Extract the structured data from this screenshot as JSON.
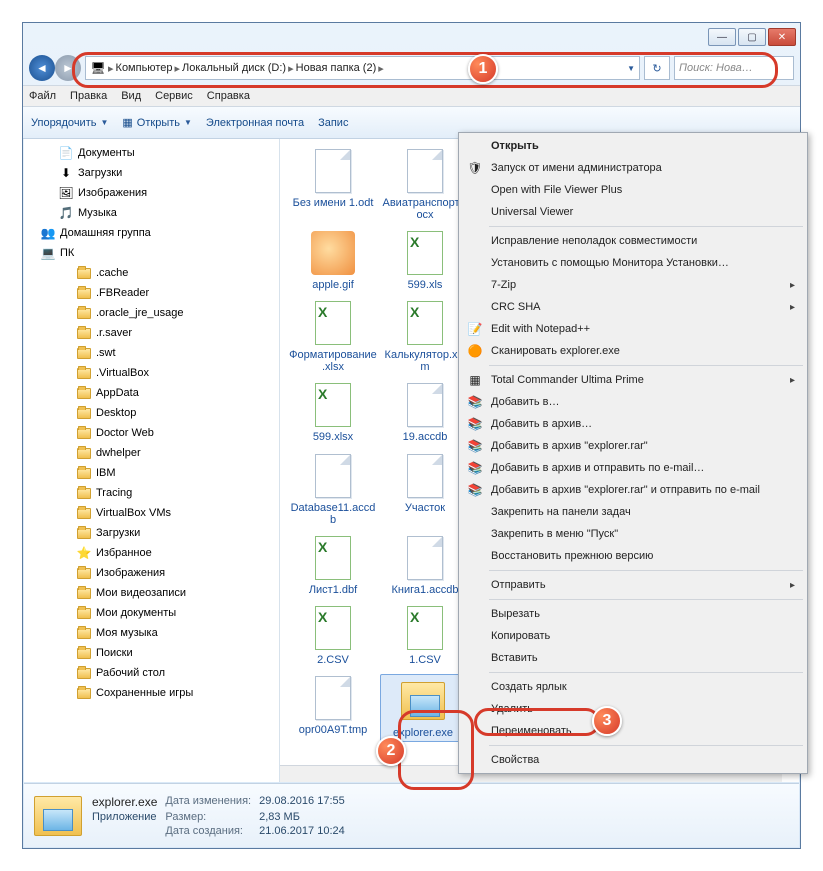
{
  "window_controls": {
    "min": "—",
    "max": "▢",
    "close": "✕"
  },
  "breadcrumb": {
    "root_icon": "computer-icon",
    "seg1": "Компьютер",
    "seg2": "Локальный диск (D:)",
    "seg3": "Новая папка (2)"
  },
  "search_placeholder": "Поиск: Нова…",
  "menu": {
    "file": "Файл",
    "edit": "Правка",
    "view": "Вид",
    "tools": "Сервис",
    "help": "Справка"
  },
  "toolbar": {
    "organize": "Упорядочить",
    "open": "Открыть",
    "email": "Электронная почта",
    "burn": "Запис"
  },
  "tree": [
    {
      "label": "Документы",
      "icon": "doc",
      "lvl": 1
    },
    {
      "label": "Загрузки",
      "icon": "dl",
      "lvl": 1
    },
    {
      "label": "Изображения",
      "icon": "pic",
      "lvl": 1
    },
    {
      "label": "Музыка",
      "icon": "music",
      "lvl": 1
    },
    {
      "label": "Домашняя группа",
      "icon": "group",
      "lvl": 0
    },
    {
      "label": "ПК",
      "icon": "pc",
      "lvl": 0
    },
    {
      "label": ".cache",
      "icon": "folder",
      "lvl": 2
    },
    {
      "label": ".FBReader",
      "icon": "folder",
      "lvl": 2
    },
    {
      "label": ".oracle_jre_usage",
      "icon": "folder",
      "lvl": 2
    },
    {
      "label": ".r.saver",
      "icon": "folder",
      "lvl": 2
    },
    {
      "label": ".swt",
      "icon": "folder",
      "lvl": 2
    },
    {
      "label": ".VirtualBox",
      "icon": "folder",
      "lvl": 2
    },
    {
      "label": "AppData",
      "icon": "folder",
      "lvl": 2
    },
    {
      "label": "Desktop",
      "icon": "folder",
      "lvl": 2
    },
    {
      "label": "Doctor Web",
      "icon": "folder",
      "lvl": 2
    },
    {
      "label": "dwhelper",
      "icon": "folder",
      "lvl": 2
    },
    {
      "label": "IBM",
      "icon": "folder",
      "lvl": 2
    },
    {
      "label": "Tracing",
      "icon": "folder",
      "lvl": 2
    },
    {
      "label": "VirtualBox VMs",
      "icon": "folder",
      "lvl": 2
    },
    {
      "label": "Загрузки",
      "icon": "folder",
      "lvl": 2
    },
    {
      "label": "Избранное",
      "icon": "fav",
      "lvl": 2
    },
    {
      "label": "Изображения",
      "icon": "folder",
      "lvl": 2
    },
    {
      "label": "Мои видеозаписи",
      "icon": "folder",
      "lvl": 2
    },
    {
      "label": "Мои документы",
      "icon": "folder",
      "lvl": 2
    },
    {
      "label": "Моя музыка",
      "icon": "folder",
      "lvl": 2
    },
    {
      "label": "Поиски",
      "icon": "folder",
      "lvl": 2
    },
    {
      "label": "Рабочий стол",
      "icon": "folder",
      "lvl": 2
    },
    {
      "label": "Сохраненные игры",
      "icon": "folder",
      "lvl": 2
    }
  ],
  "files": [
    {
      "name": "Без имени 1.odt",
      "icon": "doc"
    },
    {
      "name": "Авиатранспорт.docx",
      "icon": "word"
    },
    {
      "name": "apple.gif",
      "icon": "pic"
    },
    {
      "name": "599.xls",
      "icon": "xls"
    },
    {
      "name": "Форматирование.xlsx",
      "icon": "xls"
    },
    {
      "name": "Калькулятор.xlsm",
      "icon": "xls"
    },
    {
      "name": "599.xlsx",
      "icon": "xls"
    },
    {
      "name": "19.accdb",
      "icon": "acc"
    },
    {
      "name": "Database11.accdb",
      "icon": "doc"
    },
    {
      "name": "Участок",
      "icon": "doc"
    },
    {
      "name": "Лист1.dbf",
      "icon": "xls"
    },
    {
      "name": "Книга1.accdb",
      "icon": "doc"
    },
    {
      "name": "2.CSV",
      "icon": "csv"
    },
    {
      "name": "1.CSV",
      "icon": "csv"
    },
    {
      "name": "opr00A9T.tmp",
      "icon": "doc"
    },
    {
      "name": "explorer.exe",
      "icon": "expl",
      "selected": true
    }
  ],
  "context_menu": [
    {
      "label": "Открыть",
      "bold": true
    },
    {
      "label": "Запуск от имени администратора",
      "icon": "shield"
    },
    {
      "label": "Open with File Viewer Plus"
    },
    {
      "label": "Universal Viewer"
    },
    {
      "sep": true
    },
    {
      "label": "Исправление неполадок совместимости"
    },
    {
      "label": "Установить с помощью Монитора Установки…"
    },
    {
      "label": "7-Zip",
      "arrow": true
    },
    {
      "label": "CRC SHA",
      "arrow": true
    },
    {
      "label": "Edit with Notepad++",
      "icon": "npp"
    },
    {
      "label": "Сканировать explorer.exe",
      "icon": "avast"
    },
    {
      "sep": true
    },
    {
      "label": "Total Commander Ultima Prime",
      "icon": "tc",
      "arrow": true
    },
    {
      "label": "Добавить в…",
      "icon": "rar"
    },
    {
      "label": "Добавить в архив…",
      "icon": "rar"
    },
    {
      "label": "Добавить в архив \"explorer.rar\"",
      "icon": "rar"
    },
    {
      "label": "Добавить в архив и отправить по e-mail…",
      "icon": "rar"
    },
    {
      "label": "Добавить в архив \"explorer.rar\" и отправить по e-mail",
      "icon": "rar"
    },
    {
      "label": "Закрепить на панели задач"
    },
    {
      "label": "Закрепить в меню \"Пуск\""
    },
    {
      "label": "Восстановить прежнюю версию"
    },
    {
      "sep": true
    },
    {
      "label": "Отправить",
      "arrow": true
    },
    {
      "sep": true
    },
    {
      "label": "Вырезать"
    },
    {
      "label": "Копировать"
    },
    {
      "label": "Вставить"
    },
    {
      "sep": true
    },
    {
      "label": "Создать ярлык"
    },
    {
      "label": "Удалить"
    },
    {
      "label": "Переименовать"
    },
    {
      "sep": true
    },
    {
      "label": "Свойства"
    }
  ],
  "details": {
    "name": "explorer.exe",
    "type": "Приложение",
    "mod_label": "Дата изменения:",
    "mod_val": "29.08.2016 17:55",
    "size_label": "Размер:",
    "size_val": "2,83 МБ",
    "created_label": "Дата создания:",
    "created_val": "21.06.2017 10:24"
  },
  "callouts": {
    "b1": "1",
    "b2": "2",
    "b3": "3"
  }
}
